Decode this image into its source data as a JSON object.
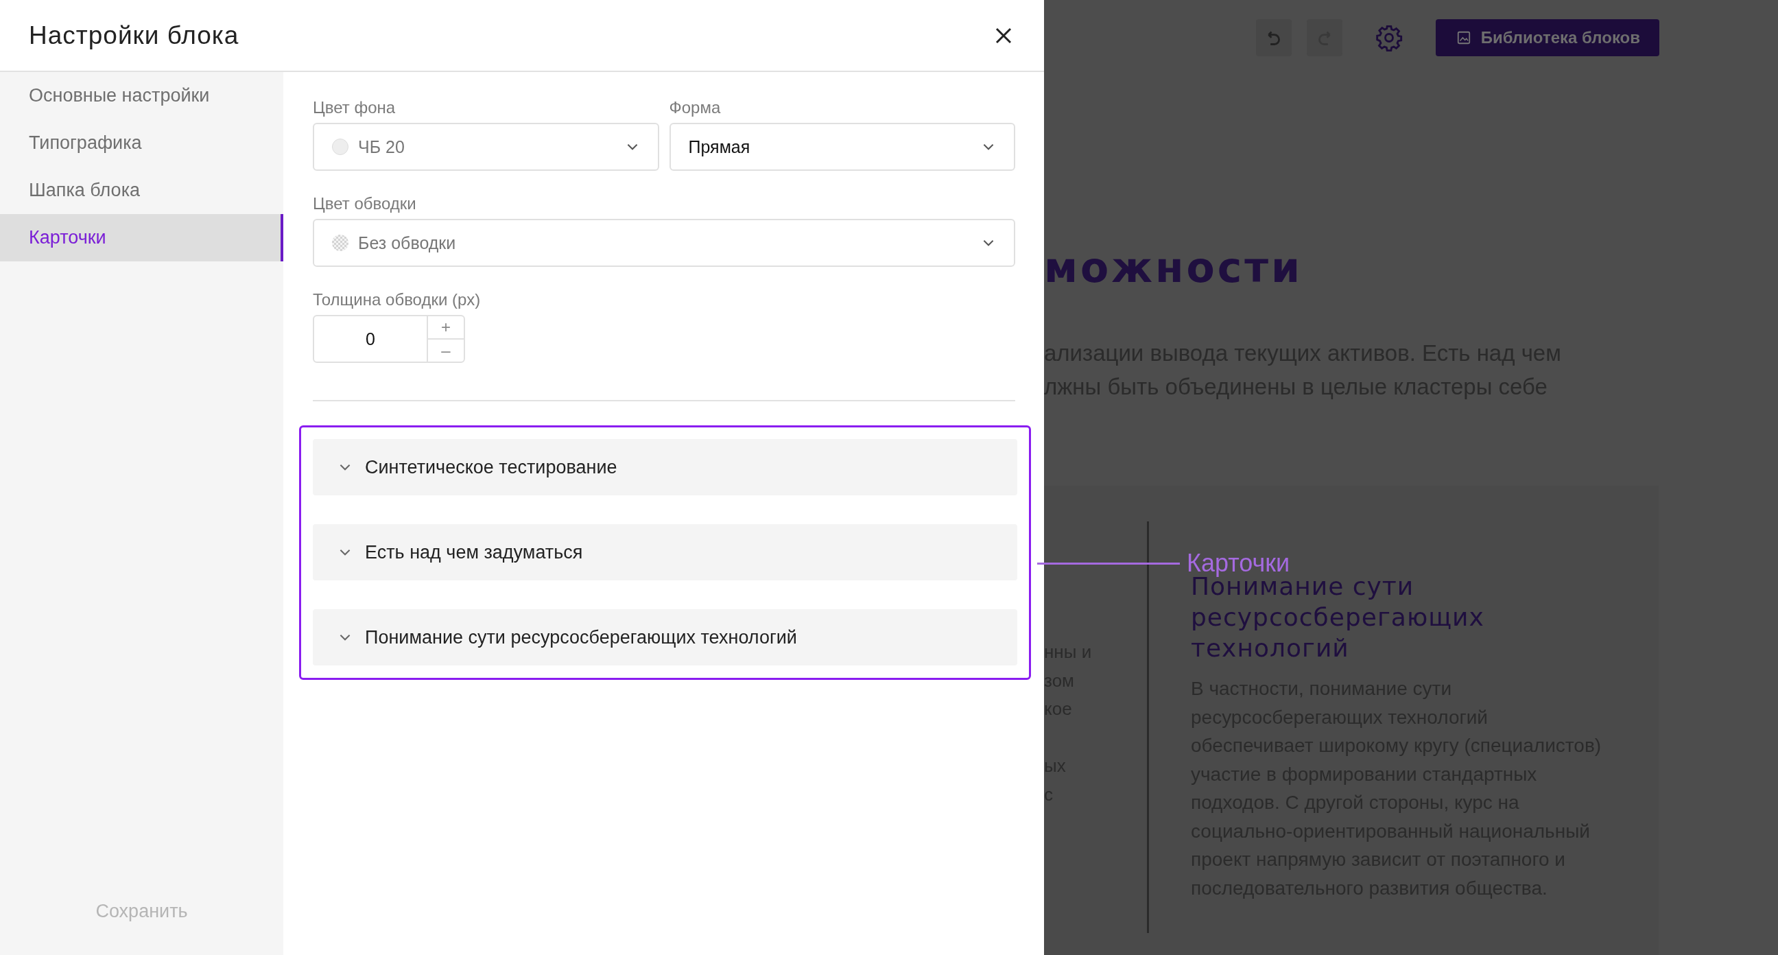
{
  "modal": {
    "title": "Настройки блока",
    "sidebar": {
      "items": [
        {
          "label": "Основные настройки",
          "selected": false
        },
        {
          "label": "Типографика",
          "selected": false
        },
        {
          "label": "Шапка блока",
          "selected": false
        },
        {
          "label": "Карточки",
          "selected": true
        }
      ],
      "save_button": {
        "label": "Сохранить",
        "disabled": true
      }
    },
    "fields": {
      "background_color": {
        "label": "Цвет фона",
        "value": "ЧБ 20"
      },
      "shape": {
        "label": "Форма",
        "value": "Прямая"
      },
      "stroke_color": {
        "label": "Цвет обводки",
        "value": "Без обводки"
      },
      "stroke_width": {
        "label": "Толщина обводки (px)",
        "value": "0",
        "increment": "+",
        "decrement": "–"
      }
    },
    "cards": [
      {
        "title": "Синтетическое тестирование",
        "expanded": false
      },
      {
        "title": "Есть над чем задуматься",
        "expanded": false
      },
      {
        "title": "Понимание сути ресурсосберегающих технологий",
        "expanded": false
      }
    ]
  },
  "highlight": {
    "label": "Карточки"
  },
  "page": {
    "toolbar": {
      "undo": {
        "disabled": false
      },
      "redo": {
        "disabled": true
      },
      "library_button": "Библиотека блоков"
    },
    "heading": "можности",
    "intro_lines": [
      "ализации вывода текущих активов. Есть над чем",
      "лжны быть объединены в целые кластеры себе"
    ],
    "left_fragments": [
      "нны и",
      "зом",
      "кое",
      "ых",
      "с"
    ],
    "card": {
      "title": "Понимание сути ресурсосберегающих технологий",
      "body": "В частности, понимание сути ресурсосберегающих технологий обеспечивает широкому кругу (специалистов) участие в формировании стандартных подходов. С другой стороны, курс на социально-ориентированный национальный проект напрямую зависит от поэтапного и последовательного развития общества."
    }
  }
}
